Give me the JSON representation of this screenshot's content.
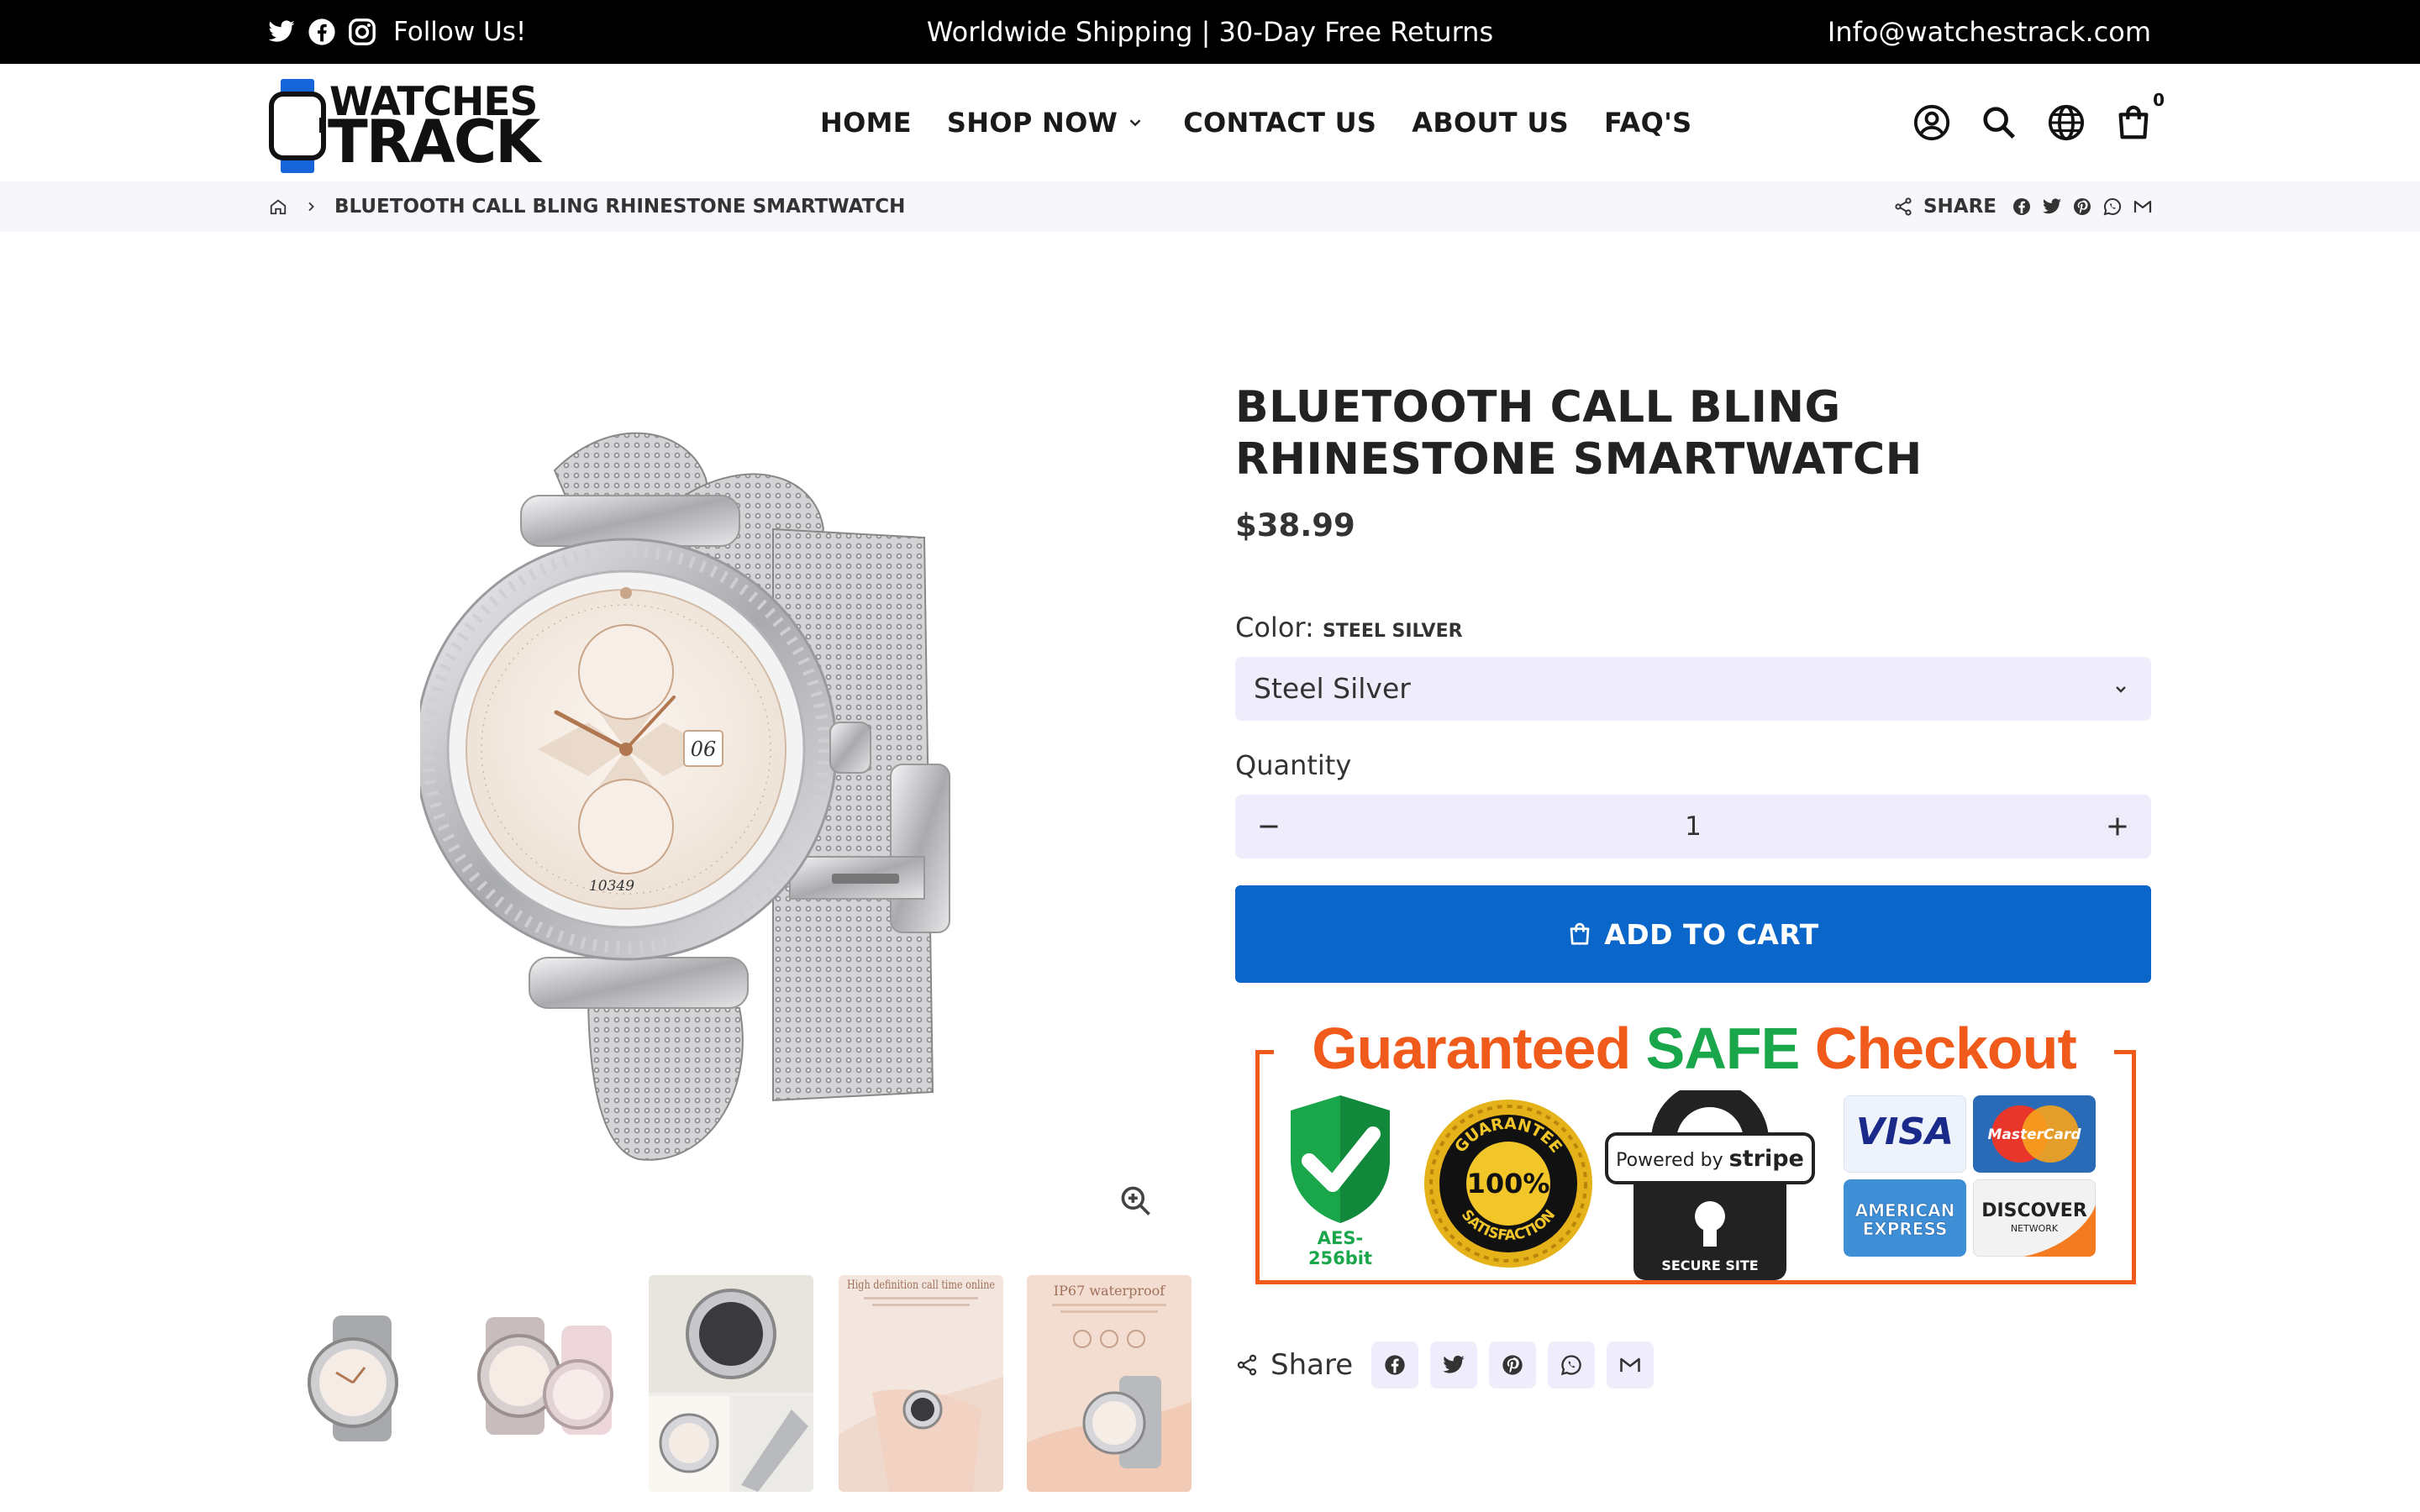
{
  "topbar": {
    "follow": "Follow Us!",
    "announcement": "Worldwide Shipping | 30-Day Free Returns",
    "email": "Info@watchestrack.com",
    "social_icons": [
      "twitter-icon",
      "facebook-icon",
      "instagram-icon"
    ]
  },
  "header": {
    "logo_line1": "WATCHES",
    "logo_line2": "TRACK",
    "nav": [
      "HOME",
      "SHOP NOW",
      "CONTACT US",
      "ABOUT US",
      "FAQ'S"
    ],
    "icons": [
      "account-icon",
      "search-icon",
      "globe-icon",
      "cart-icon"
    ],
    "cart_count": "0"
  },
  "breadcrumb": {
    "current": "BLUETOOTH CALL BLING RHINESTONE SMARTWATCH",
    "share_label": "SHARE"
  },
  "product": {
    "title": "BLUETOOTH CALL BLING RHINESTONE SMARTWATCH",
    "price": "$38.99",
    "color_label": "Color:",
    "color_value": "STEEL SILVER",
    "color_selected": "Steel Silver",
    "quantity_label": "Quantity",
    "quantity": "1",
    "add_to_cart": "ADD TO CART",
    "share_label": "Share"
  },
  "main_watch": {
    "date": "06",
    "steps": "10349"
  },
  "thumbnails": {
    "thumb4_title": "High definition call time online",
    "thumb5_title": "IP67 waterproof"
  },
  "safe_checkout": {
    "word1": "Guaranteed",
    "word2": "SAFE",
    "word3": "Checkout",
    "aes": "AES-256bit",
    "seal_top": "GUARANTEE",
    "seal_mid": "100%",
    "seal_bottom": "SATISFACTION",
    "powered_by": "Powered by",
    "stripe": "stripe",
    "secure_site": "SECURE SITE",
    "visa": "VISA",
    "mastercard": "MasterCard",
    "amex_1": "AMERICAN",
    "amex_2": "EXPRESS",
    "discover": "DISCOVER",
    "network": "NETWORK"
  },
  "colors": {
    "accent": "#0a66c8",
    "input_bg": "#efedfb",
    "safe_orange": "#f05a1a",
    "safe_green": "#1aa64a"
  }
}
